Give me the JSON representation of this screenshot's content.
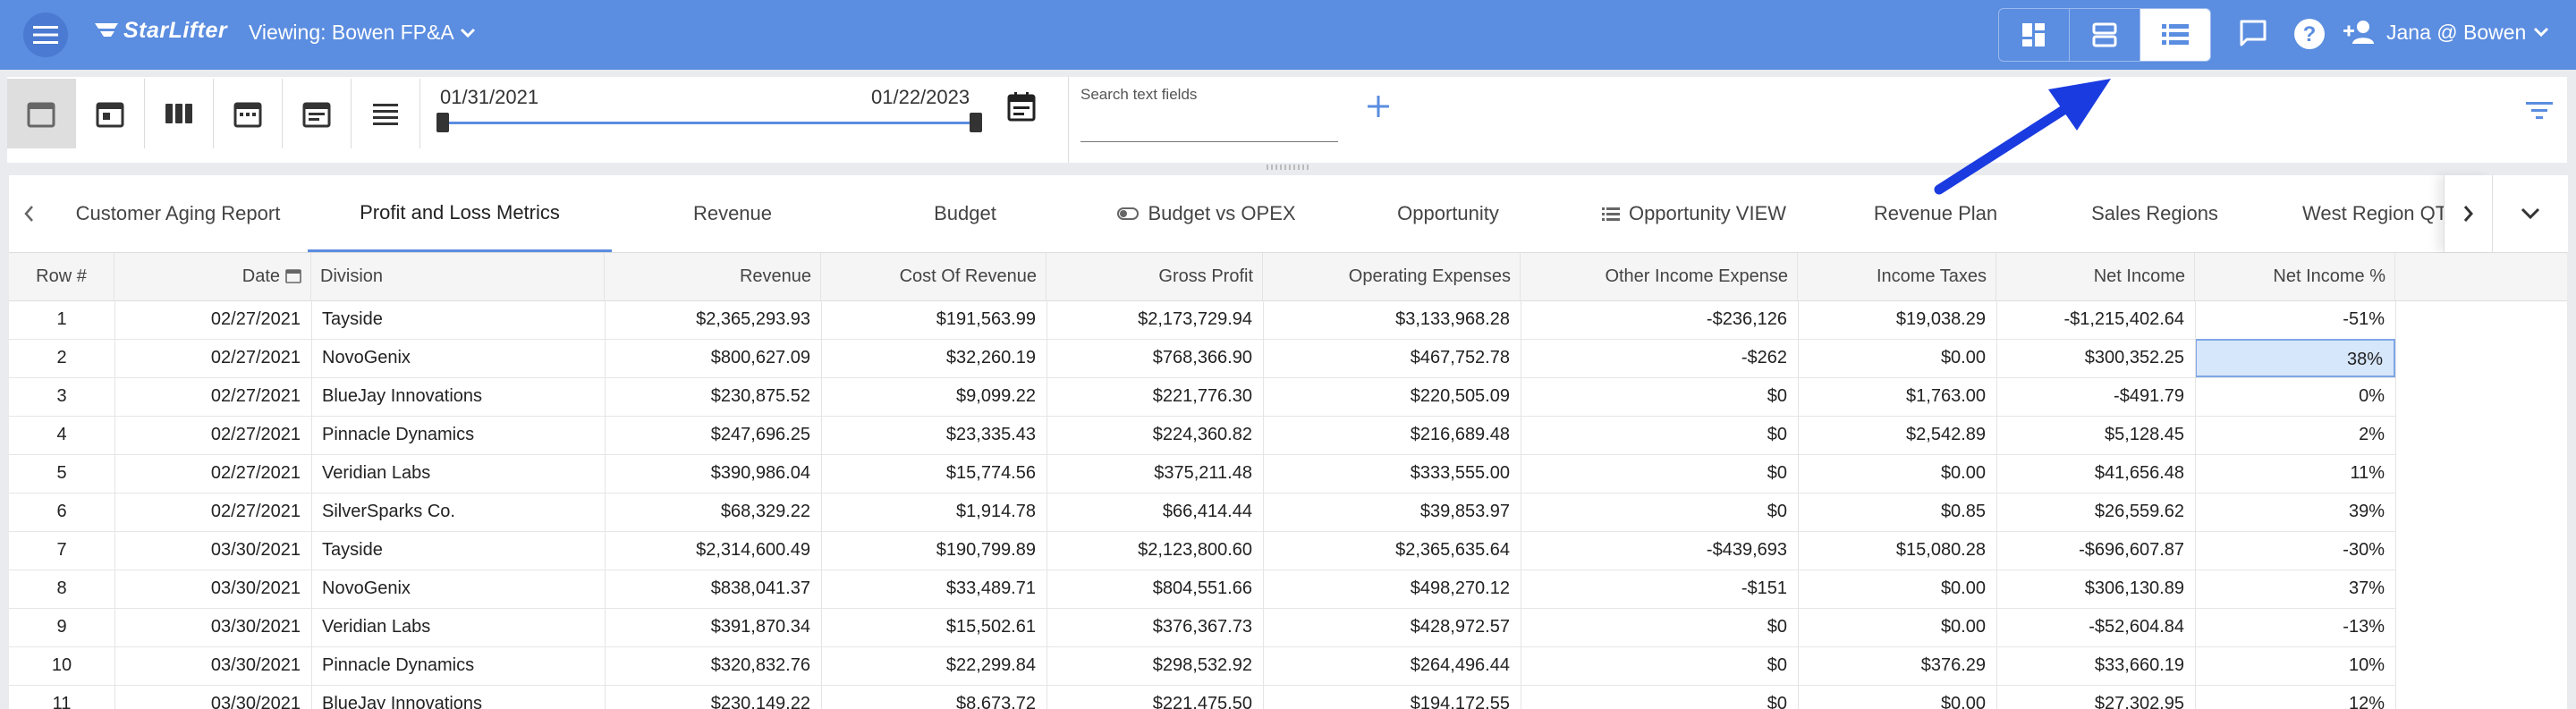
{
  "header": {
    "brand": "StarLifter",
    "viewing": "Viewing: Bowen FP&A",
    "user": "Jana @ Bowen"
  },
  "toolbar": {
    "date_start": "01/31/2021",
    "date_end": "01/22/2023",
    "search_placeholder": "Search text fields"
  },
  "tabs": [
    {
      "label": "Customer Aging Report",
      "icon": ""
    },
    {
      "label": "Profit and Loss Metrics",
      "icon": "",
      "active": true
    },
    {
      "label": "Revenue",
      "icon": ""
    },
    {
      "label": "Budget",
      "icon": ""
    },
    {
      "label": "Budget vs OPEX",
      "icon": "toggle-icon"
    },
    {
      "label": "Opportunity",
      "icon": ""
    },
    {
      "label": "Opportunity VIEW",
      "icon": "list-icon"
    },
    {
      "label": "Revenue Plan",
      "icon": ""
    },
    {
      "label": "Sales Regions",
      "icon": ""
    },
    {
      "label": "West Region QTD",
      "icon": ""
    }
  ],
  "table": {
    "columns": [
      "Row #",
      "Date",
      "Division",
      "Revenue",
      "Cost Of Revenue",
      "Gross Profit",
      "Operating Expenses",
      "Other Income Expense",
      "Income Taxes",
      "Net Income",
      "Net Income %"
    ],
    "rows": [
      [
        "1",
        "02/27/2021",
        "Tayside",
        "$2,365,293.93",
        "$191,563.99",
        "$2,173,729.94",
        "$3,133,968.28",
        "-$236,126",
        "$19,038.29",
        "-$1,215,402.64",
        "-51%"
      ],
      [
        "2",
        "02/27/2021",
        "NovoGenix",
        "$800,627.09",
        "$32,260.19",
        "$768,366.90",
        "$467,752.78",
        "-$262",
        "$0.00",
        "$300,352.25",
        "38%"
      ],
      [
        "3",
        "02/27/2021",
        "BlueJay Innovations",
        "$230,875.52",
        "$9,099.22",
        "$221,776.30",
        "$220,505.09",
        "$0",
        "$1,763.00",
        "-$491.79",
        "0%"
      ],
      [
        "4",
        "02/27/2021",
        "Pinnacle Dynamics",
        "$247,696.25",
        "$23,335.43",
        "$224,360.82",
        "$216,689.48",
        "$0",
        "$2,542.89",
        "$5,128.45",
        "2%"
      ],
      [
        "5",
        "02/27/2021",
        "Veridian Labs",
        "$390,986.04",
        "$15,774.56",
        "$375,211.48",
        "$333,555.00",
        "$0",
        "$0.00",
        "$41,656.48",
        "11%"
      ],
      [
        "6",
        "02/27/2021",
        "SilverSparks Co.",
        "$68,329.22",
        "$1,914.78",
        "$66,414.44",
        "$39,853.97",
        "$0",
        "$0.85",
        "$26,559.62",
        "39%"
      ],
      [
        "7",
        "03/30/2021",
        "Tayside",
        "$2,314,600.49",
        "$190,799.89",
        "$2,123,800.60",
        "$2,365,635.64",
        "-$439,693",
        "$15,080.28",
        "-$696,607.87",
        "-30%"
      ],
      [
        "8",
        "03/30/2021",
        "NovoGenix",
        "$838,041.37",
        "$33,489.71",
        "$804,551.66",
        "$498,270.12",
        "-$151",
        "$0.00",
        "$306,130.89",
        "37%"
      ],
      [
        "9",
        "03/30/2021",
        "Veridian Labs",
        "$391,870.34",
        "$15,502.61",
        "$376,367.73",
        "$428,972.57",
        "$0",
        "$0.00",
        "-$52,604.84",
        "-13%"
      ],
      [
        "10",
        "03/30/2021",
        "Pinnacle Dynamics",
        "$320,832.76",
        "$22,299.84",
        "$298,532.92",
        "$264,496.44",
        "$0",
        "$376.29",
        "$33,660.19",
        "10%"
      ],
      [
        "11",
        "03/30/2021",
        "BlueJay Innovations",
        "$230,149.22",
        "$8,673.72",
        "$221,475.50",
        "$194,172.55",
        "$0",
        "$0.00",
        "$27,302.95",
        "12%"
      ]
    ],
    "selected_cell": {
      "row": 2,
      "column": "Net Income %"
    }
  },
  "colors": {
    "header_bg": "#5b8de0",
    "accent": "#5b8de0",
    "annotation_arrow": "#1a3be0"
  }
}
